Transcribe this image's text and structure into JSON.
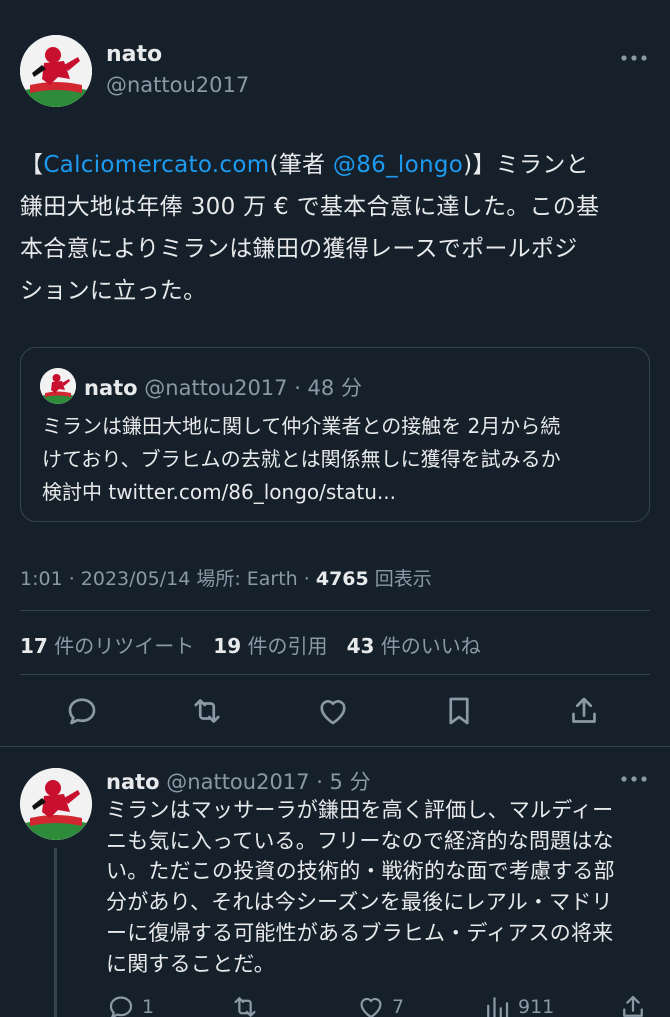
{
  "main_tweet": {
    "author_name": "nato",
    "author_handle": "@nattou2017",
    "text_bracket_open": "【",
    "text_source_link": "Calciomercato.com",
    "text_author_prefix": "(筆者 ",
    "text_author_link": "@86_longo",
    "text_author_suffix": ")】",
    "text_line1_rest": "ミランと",
    "text_line2": "鎌田大地は年俸 300 万 € で基本合意に達した。この基",
    "text_line3": "本合意によりミランは鎌田の獲得レースでポールポジ",
    "text_line4": "ションに立った。",
    "meta_time": "1:01 · 2023/05/14 場所: Earth · ",
    "views_count": "4765",
    "views_label": " 回表示",
    "retweets_count": "17",
    "retweets_label": " 件のリツイート",
    "quotes_count": "19",
    "quotes_label": " 件の引用",
    "likes_count": "43",
    "likes_label": " 件のいいね"
  },
  "quoted_tweet": {
    "author_name": "nato",
    "author_handle": "@nattou2017",
    "time": " · 48 分",
    "line1": "ミランは鎌田大地に関して仲介業者との接触を 2月から続",
    "line2": "けており、ブラヒムの去就とは関係無しに獲得を試みるか",
    "line3": "検討中 twitter.com/86_longo/statu..."
  },
  "reply_tweet": {
    "author_name": "nato",
    "author_handle": "@nattou2017",
    "time": " · 5 分",
    "line1": "ミランはマッサーラが鎌田を高く評価し、マルディー",
    "line2": "ニも気に入っている。フリーなので経済的な問題はな",
    "line3": "い。ただこの投資の技術的・戦術的な面で考慮する部",
    "line4": "分があり、それは今シーズンを最後にレアル・マドリ",
    "line5": "ーに復帰する可能性があるブラヒム・ディアスの将来",
    "line6": "に関することだ。",
    "reply_count": "1",
    "like_count": "7",
    "view_count": "911"
  },
  "icons": {
    "more": "more-horizontal-icon",
    "reply": "chat-bubble-icon",
    "retweet": "retweet-arrows-icon",
    "like": "heart-icon",
    "bookmark": "bookmark-icon",
    "share": "share-upload-icon",
    "views": "bar-chart-icon"
  },
  "colors": {
    "background": "#15202b",
    "text": "#e7e9ea",
    "muted": "#8b98a5",
    "link": "#1d9bf0",
    "border": "#38444d"
  }
}
